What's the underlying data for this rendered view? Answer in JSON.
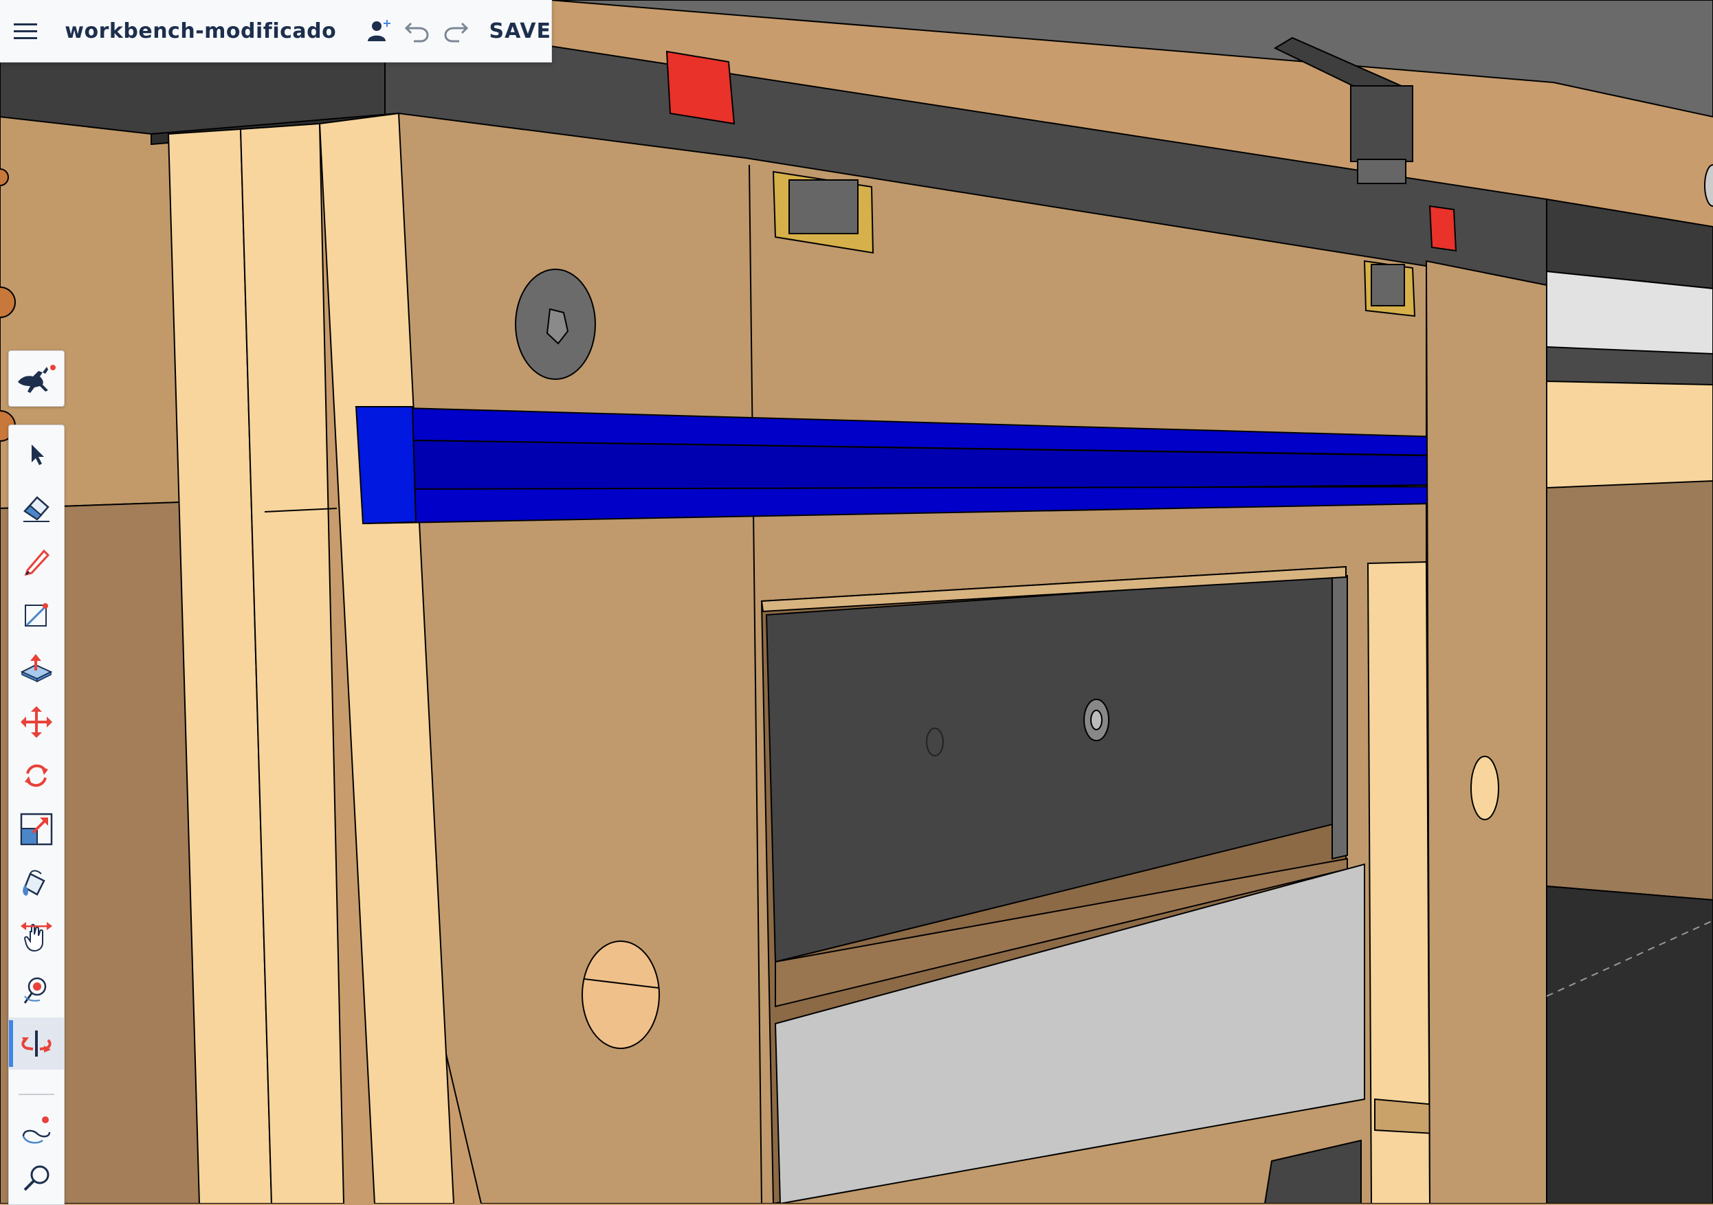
{
  "app": {
    "document_title": "workbench-modificado",
    "save_label": "SAVE"
  },
  "icons": {
    "menu": "hamburger-menu-icon",
    "share": "add-collaborator-icon",
    "undo": "undo-icon",
    "redo": "redo-icon",
    "tool_header": "running-dog-icon"
  },
  "tools": [
    {
      "name": "select-tool",
      "icon": "arrow-pointer-icon",
      "active": false
    },
    {
      "name": "eraser-tool",
      "icon": "eraser-icon",
      "active": false
    },
    {
      "name": "pencil-tool",
      "icon": "pencil-icon",
      "active": false
    },
    {
      "name": "rectangle-tool",
      "icon": "rectangle-draw-icon",
      "active": false
    },
    {
      "name": "push-pull-tool",
      "icon": "push-pull-icon",
      "active": false
    },
    {
      "name": "move-tool",
      "icon": "move-arrows-icon",
      "active": false
    },
    {
      "name": "rotate-tool",
      "icon": "rotate-icon",
      "active": false
    },
    {
      "name": "scale-tool",
      "icon": "scale-icon",
      "active": false
    },
    {
      "name": "paint-tool",
      "icon": "paint-bucket-icon",
      "active": false
    },
    {
      "name": "pan-tool",
      "icon": "pan-hand-icon",
      "active": false
    },
    {
      "name": "orbit-look-tool",
      "icon": "orbit-pin-icon",
      "active": false
    },
    {
      "name": "orbit-tool",
      "icon": "orbit-icon",
      "active": true
    },
    {
      "name": "walk-tool",
      "icon": "walk-path-icon",
      "active": false
    },
    {
      "name": "zoom-tool",
      "icon": "magnifier-icon",
      "active": false
    }
  ],
  "colors": {
    "accent": "#3f84e6",
    "ui_text": "#1d2f4d",
    "icon_red": "#e8423a",
    "icon_blue": "#4a86c8",
    "selection_blue": "#0000c8",
    "wood_face": "#c09a6c",
    "wood_light": "#f7d59c",
    "metal_dark": "#555555"
  }
}
